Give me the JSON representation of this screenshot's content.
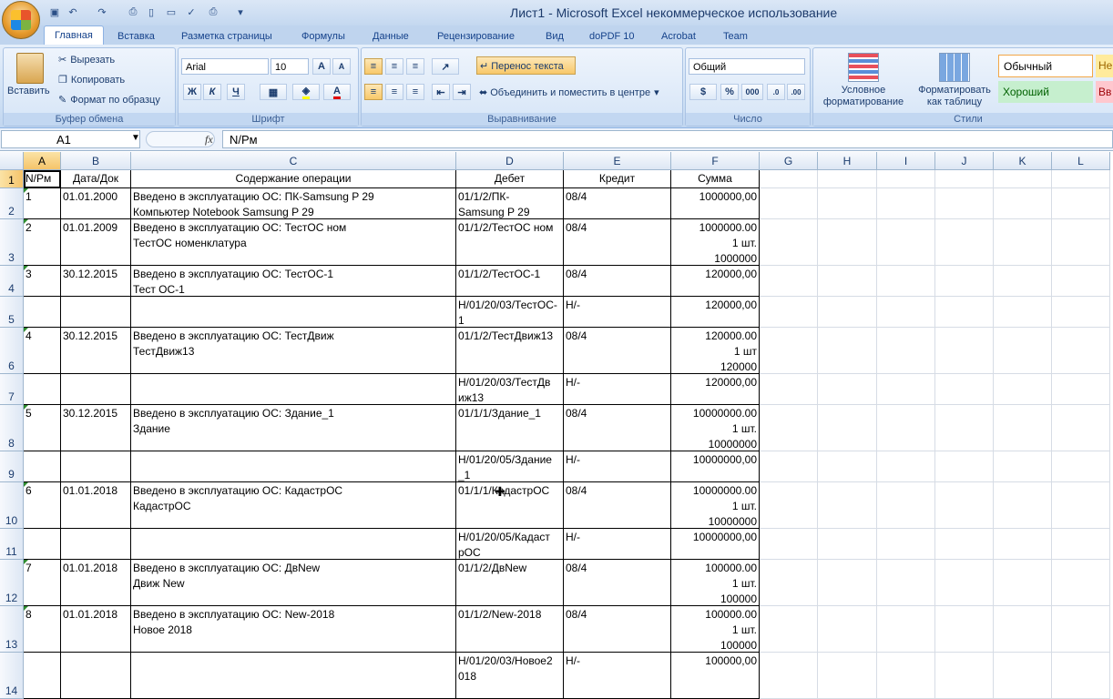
{
  "window": {
    "title": "Лист1 - Microsoft Excel некоммерческое использование"
  },
  "ribbon_tabs": [
    "Главная",
    "Вставка",
    "Разметка страницы",
    "Формулы",
    "Данные",
    "Рецензирование",
    "Вид",
    "doPDF 10",
    "Acrobat",
    "Team"
  ],
  "clipboard": {
    "paste": "Вставить",
    "cut": "Вырезать",
    "copy": "Копировать",
    "format_painter": "Формат по образцу",
    "label": "Буфер обмена"
  },
  "font": {
    "name": "Arial",
    "size": "10",
    "bold": "Ж",
    "italic": "К",
    "underline": "Ч",
    "grow": "A",
    "shrink": "A",
    "label": "Шрифт"
  },
  "alignment": {
    "wrap": "Перенос текста",
    "merge": "Объединить и поместить в центре",
    "label": "Выравнивание"
  },
  "number": {
    "format": "Общий",
    "percent": "%",
    "thousands": "000",
    "label": "Число"
  },
  "styles": {
    "conditional": "Условное\nформатирование",
    "as_table": "Форматировать\nкак таблицу",
    "normal": "Обычный",
    "good": "Хороший",
    "neutral": "Не",
    "bad": "Вв",
    "label": "Стили"
  },
  "formula_bar": {
    "name_box": "A1",
    "fx": "fx",
    "content": "N/Рм"
  },
  "columns": [
    "A",
    "B",
    "C",
    "D",
    "E",
    "F",
    "G",
    "H",
    "I",
    "J",
    "K",
    "L"
  ],
  "rows": [
    {
      "n": "1",
      "a": "N/Рм",
      "b": "Дата/Док",
      "c": "Содержание операции",
      "d": "Дебет",
      "e": "Кредит",
      "f": "Сумма"
    },
    {
      "n": "2",
      "a": "1",
      "b": "01.01.2000",
      "c": "Введено в эксплуатацию ОС: ПК-Samsung P 29\nКомпьютер Notebook Samsung P 29",
      "d": "01/1/2/ПК-\nSamsung P 29",
      "e": "08/4",
      "f": "1000000,00"
    },
    {
      "n": "3",
      "a": "2",
      "b": "01.01.2009",
      "c": "Введено в эксплуатацию ОС: ТестОС ном\nТестОС номенклатура",
      "d": "01/1/2/ТестОС ном",
      "e": "08/4",
      "f": "1000000.00\n1 шт.\n1000000"
    },
    {
      "n": "4",
      "a": "3",
      "b": "30.12.2015",
      "c": "Введено в эксплуатацию ОС: ТестОС-1\nТест ОС-1",
      "d": "01/1/2/ТестОС-1",
      "e": "08/4",
      "f": "120000,00"
    },
    {
      "n": "5",
      "a": "",
      "b": "",
      "c": "",
      "d": "Н/01/20/03/ТестОС-\n1",
      "e": "Н/-",
      "f": "120000,00"
    },
    {
      "n": "6",
      "a": "4",
      "b": "30.12.2015",
      "c": "Введено в эксплуатацию ОС: ТестДвиж\nТестДвиж13",
      "d": "01/1/2/ТестДвиж13",
      "e": "08/4",
      "f": "120000.00\n1 шт\n120000"
    },
    {
      "n": "7",
      "a": "",
      "b": "",
      "c": "",
      "d": "Н/01/20/03/ТестДв\nиж13",
      "e": "Н/-",
      "f": "120000,00"
    },
    {
      "n": "8",
      "a": "5",
      "b": "30.12.2015",
      "c": "Введено в эксплуатацию ОС: Здание_1\nЗдание",
      "d": "01/1/1/Здание_1",
      "e": "08/4",
      "f": "10000000.00\n1 шт.\n10000000"
    },
    {
      "n": "9",
      "a": "",
      "b": "",
      "c": "",
      "d": "Н/01/20/05/Здание\n_1",
      "e": "Н/-",
      "f": "10000000,00"
    },
    {
      "n": "10",
      "a": "6",
      "b": "01.01.2018",
      "c": "Введено в эксплуатацию ОС: КадастрОС\nКадастрОС",
      "d": "01/1/1/КадастрОС",
      "e": "08/4",
      "f": "10000000.00\n1 шт.\n10000000"
    },
    {
      "n": "11",
      "a": "",
      "b": "",
      "c": "",
      "d": "Н/01/20/05/Кадаст\nрОС",
      "e": "Н/-",
      "f": "10000000,00"
    },
    {
      "n": "12",
      "a": "7",
      "b": "01.01.2018",
      "c": "Введено в эксплуатацию ОС: ДвNew\nДвиж New",
      "d": "01/1/2/ДвNew",
      "e": "08/4",
      "f": "100000.00\n1 шт.\n100000"
    },
    {
      "n": "13",
      "a": "8",
      "b": "01.01.2018",
      "c": "Введено в эксплуатацию ОС: New-2018\nНовое 2018",
      "d": "01/1/2/New-2018",
      "e": "08/4",
      "f": "100000.00\n1 шт.\n100000"
    },
    {
      "n": "14",
      "a": "",
      "b": "",
      "c": "",
      "d": "Н/01/20/03/Новое2\n018",
      "e": "Н/-",
      "f": "100000,00"
    }
  ]
}
